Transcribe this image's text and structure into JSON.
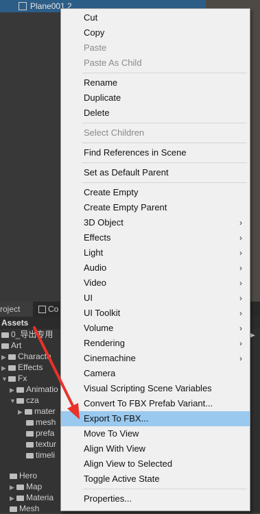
{
  "hierarchy": {
    "selected_item": "Plane001 2"
  },
  "tabs": {
    "project": "roject",
    "console": "Co"
  },
  "project": {
    "header": "Assets",
    "tree": [
      "0_导出专用",
      "Art",
      "Characte",
      "Effects",
      "Fx",
      "Animatio",
      "cza",
      "mater",
      "mesh",
      "prefa",
      "textur",
      "timeli",
      "Hero",
      "Map",
      "Materia",
      "Mesh"
    ]
  },
  "menu": {
    "items": [
      {
        "label": "Cut"
      },
      {
        "label": "Copy"
      },
      {
        "label": "Paste",
        "disabled": true
      },
      {
        "label": "Paste As Child",
        "disabled": true
      },
      {
        "label": "Rename"
      },
      {
        "label": "Duplicate"
      },
      {
        "label": "Delete"
      },
      {
        "label": "Select Children",
        "disabled": true
      },
      {
        "label": "Find References in Scene"
      },
      {
        "label": "Set as Default Parent"
      },
      {
        "label": "Create Empty"
      },
      {
        "label": "Create Empty Parent"
      },
      {
        "label": "3D Object",
        "submenu": true
      },
      {
        "label": "Effects",
        "submenu": true
      },
      {
        "label": "Light",
        "submenu": true
      },
      {
        "label": "Audio",
        "submenu": true
      },
      {
        "label": "Video",
        "submenu": true
      },
      {
        "label": "UI",
        "submenu": true
      },
      {
        "label": "UI Toolkit",
        "submenu": true
      },
      {
        "label": "Volume",
        "submenu": true
      },
      {
        "label": "Rendering",
        "submenu": true
      },
      {
        "label": "Cinemachine",
        "submenu": true
      },
      {
        "label": "Camera"
      },
      {
        "label": "Visual Scripting Scene Variables"
      },
      {
        "label": "Convert To FBX Prefab Variant..."
      },
      {
        "label": "Export To FBX...",
        "highlighted": true
      },
      {
        "label": "Move To View"
      },
      {
        "label": "Align With View"
      },
      {
        "label": "Align View to Selected"
      },
      {
        "label": "Toggle Active State"
      },
      {
        "label": "Properties..."
      }
    ]
  },
  "annotation": {
    "color": "#e8322a"
  },
  "icons": {
    "submenu": "chevron-right-icon",
    "folder": "folder-icon",
    "gameobject": "cube-icon"
  }
}
